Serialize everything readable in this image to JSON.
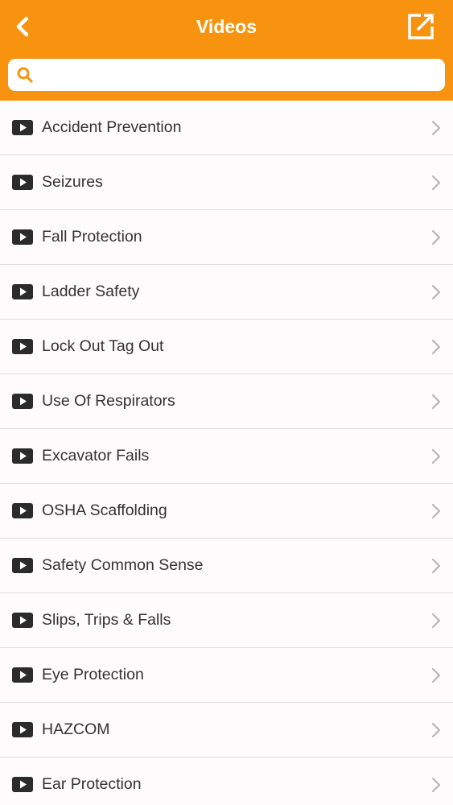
{
  "header": {
    "title": "Videos",
    "back_icon": "chevron-left-icon",
    "compose_icon": "external-link-icon",
    "background_color": "#f7930f"
  },
  "search": {
    "icon": "search-icon",
    "value": "",
    "placeholder": ""
  },
  "list": {
    "row_icon": "play-icon",
    "row_chevron": "chevron-right-icon",
    "items": [
      {
        "label": "Accident Prevention"
      },
      {
        "label": "Seizures"
      },
      {
        "label": "Fall Protection"
      },
      {
        "label": "Ladder Safety"
      },
      {
        "label": "Lock Out Tag Out"
      },
      {
        "label": "Use Of Respirators"
      },
      {
        "label": "Excavator Fails"
      },
      {
        "label": "OSHA Scaffolding"
      },
      {
        "label": "Safety Common Sense"
      },
      {
        "label": "Slips, Trips & Falls"
      },
      {
        "label": "Eye Protection"
      },
      {
        "label": "HAZCOM"
      },
      {
        "label": "Ear Protection"
      }
    ]
  }
}
